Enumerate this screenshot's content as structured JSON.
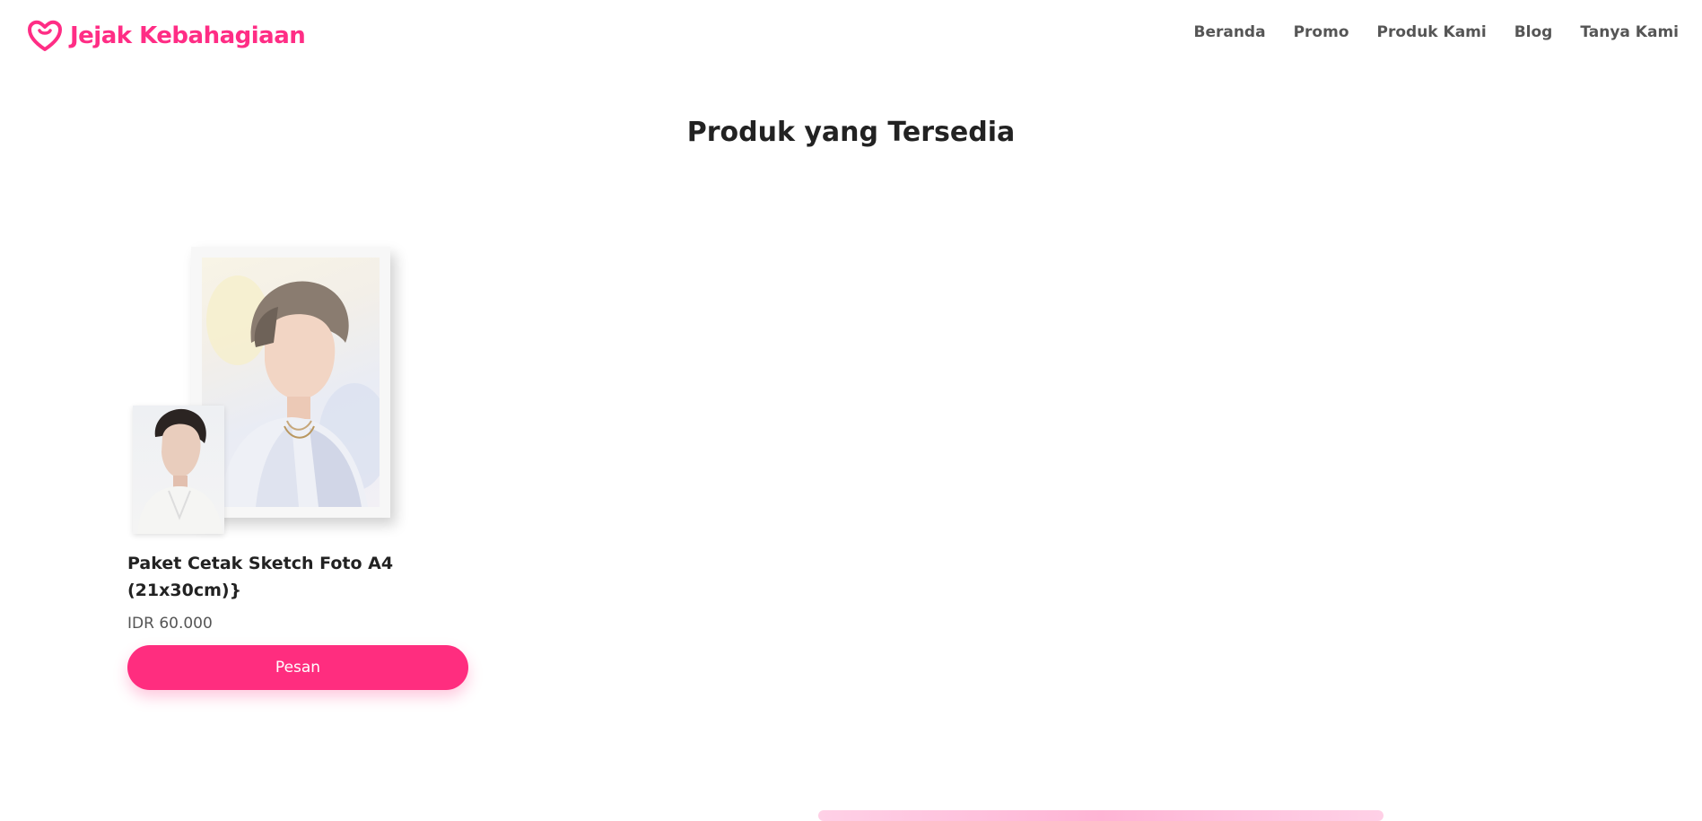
{
  "brand": {
    "name": "Jejak Kebahagiaan",
    "color": "#ff2d85"
  },
  "nav": {
    "items": [
      {
        "label": "Beranda"
      },
      {
        "label": "Promo"
      },
      {
        "label": "Produk Kami"
      },
      {
        "label": "Blog"
      },
      {
        "label": "Tanya Kami"
      }
    ]
  },
  "main": {
    "title": "Produk yang Tersedia",
    "products": [
      {
        "name": "Paket Cetak Sketch Foto A4 (21x30cm)}",
        "price": "IDR 60.000",
        "button_label": "Pesan"
      }
    ]
  },
  "colors": {
    "accent": "#ff2d7f",
    "text": "#222222",
    "muted": "#555555"
  }
}
